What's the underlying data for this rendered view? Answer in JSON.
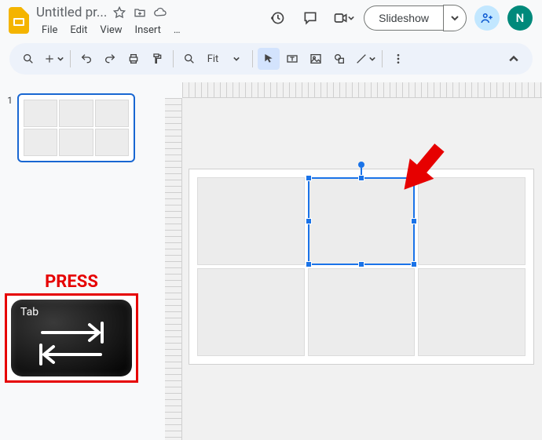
{
  "doc": {
    "title": "Untitled pr..."
  },
  "menus": {
    "file": "File",
    "edit": "Edit",
    "view": "View",
    "insert": "Insert",
    "more": "…"
  },
  "toolbar": {
    "fit_label": "Fit"
  },
  "slideshow": {
    "label": "Slideshow"
  },
  "avatar": {
    "initial": "N"
  },
  "filmstrip": {
    "slides": [
      {
        "number": "1"
      }
    ]
  },
  "annotation": {
    "press_label": "PRESS",
    "key_label": "Tab"
  }
}
